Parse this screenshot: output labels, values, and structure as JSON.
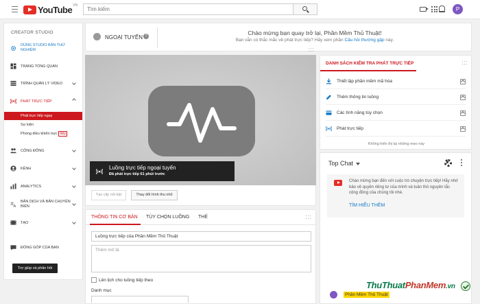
{
  "header": {
    "logo_text": "YouTube",
    "logo_region": "VN",
    "search_placeholder": "Tìm kiếm",
    "avatar_letter": "P"
  },
  "sidebar": {
    "title": "CREATOR STUDIO",
    "items": [
      {
        "label": "DÙNG STUDIO BẢN THỬ NGHIỆM",
        "icon": "gear-icon",
        "color": "#167ac6"
      },
      {
        "label": "TRANG TỔNG QUAN",
        "icon": "dashboard-icon"
      },
      {
        "label": "TRÌNH QUẢN LÝ VIDEO",
        "icon": "video-manager-icon"
      },
      {
        "label": "PHÁT TRỰC TIẾP",
        "icon": "live-icon",
        "color": "#cc181e"
      },
      {
        "label": "CỘNG ĐỒNG",
        "icon": "community-icon"
      },
      {
        "label": "KÊNH",
        "icon": "channel-icon"
      },
      {
        "label": "ANALYTICS",
        "icon": "analytics-icon"
      },
      {
        "label": "BẢN DỊCH VÀ BẢN CHUYỂN BIÊN",
        "icon": "translate-icon"
      },
      {
        "label": "TẠO",
        "icon": "create-icon"
      },
      {
        "label": "ĐÓNG GÓP CỦA BẠN",
        "icon": "contribute-icon"
      }
    ],
    "live_sub": [
      "Phát trực tiếp ngay",
      "Sự kiện",
      "Phòng điều khiển trực"
    ],
    "live_sub_badge": "tiếp",
    "help_button": "Trợ giúp và phản hồi"
  },
  "status": {
    "state": "NGOẠI TUYẾN",
    "help_glyph": "?",
    "welcome": "Chào mừng bạn quay trở lại, Phần Mềm Thủ Thuật!",
    "sub_prefix": "Bạn vẫn có thắc mắc về phát trực tiếp? Hãy xem phần",
    "sub_link": "Câu hỏi thường gặp",
    "sub_suffix": " này."
  },
  "player": {
    "overlay_title": "Luồng trực tiếp ngoại tuyến",
    "overlay_sub": "Đã phát trực tiếp 61 phút trước",
    "clip_button": "Tạo clip nổi bật",
    "thumb_button": "Thay đổi hình thu nhỏ"
  },
  "info": {
    "tabs": [
      "THÔNG TIN CƠ BẢN",
      "TÙY CHỌN LUỒNG",
      "THẺ"
    ],
    "title_value": "Luồng trực tiếp của Phần Mềm Thủ Thuật",
    "desc_placeholder": "Thêm mô tả",
    "schedule_label": "Lên lịch cho luồng tiếp theo",
    "category_label": "Danh mục"
  },
  "checklist": {
    "title": "DANH SÁCH KIỂM TRA PHÁT TRỰC TIẾP",
    "items": [
      {
        "label": "Thiết lập phần mềm mã hóa",
        "icon": "download-icon"
      },
      {
        "label": "Thêm thông tin luồng",
        "icon": "edit-icon"
      },
      {
        "label": "Các tính năng tùy chọn",
        "icon": "card-icon"
      },
      {
        "label": "Phát trực tiếp",
        "icon": "live-icon"
      }
    ],
    "footer": "Không hiển thị lại những mẹo này"
  },
  "chat": {
    "title": "Top Chat",
    "message": "Chào mừng bạn đến với cuộc trò chuyện trực tiếp! Hãy nhớ bảo vệ quyền riêng tư của mình và tuân thủ nguyên tắc cộng đồng của chúng tôi nhé.",
    "learn_more": "TÌM HIỂU THÊM",
    "author": "Phần Mềm Thủ Thuật"
  },
  "watermark": {
    "part1": "ThuThuat",
    "part2": "PhanMem",
    "suffix": ".vn"
  },
  "colors": {
    "accent": "#cc181e",
    "link": "#167ac6",
    "brand": "#e52d27"
  }
}
